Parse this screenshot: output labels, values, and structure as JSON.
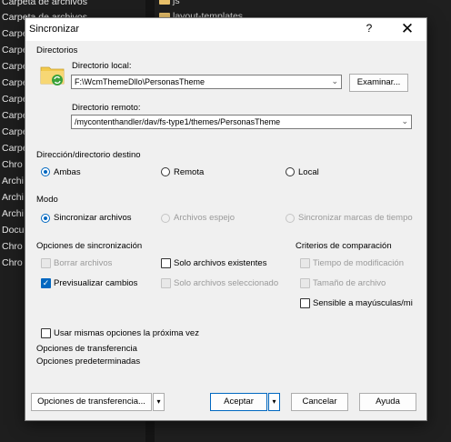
{
  "background": {
    "left_items": [
      "Carpeta de archivos",
      "Carpeta de archivos",
      "Carpe",
      "Carpe",
      "Carpe",
      "Carpe",
      "Carpe",
      "Carpe",
      "Carpe",
      "Carpe",
      "Chro",
      "Archi",
      "Archi",
      "Archi",
      "Docu",
      "Chro",
      "Chro"
    ],
    "right_items": [
      "js",
      "layout-templates"
    ]
  },
  "dialog": {
    "title": "Sincronizar",
    "help_label": "?",
    "close_label": "✕",
    "directories_heading": "Directorios",
    "local_dir_label": "Directorio local:",
    "local_dir_value": "F:\\WcmThemeDllo\\PersonasTheme",
    "browse_label": "Examinar...",
    "remote_dir_label": "Directorio remoto:",
    "remote_dir_value": "/mycontenthandler/dav/fs-type1/themes/PersonasTheme",
    "direction_heading": "Dirección/directorio destino",
    "direction_options": [
      "Ambas",
      "Remota",
      "Local"
    ],
    "direction_selected": "Ambas",
    "mode_heading": "Modo",
    "mode_options": [
      "Sincronizar archivos",
      "Archivos espejo",
      "Sincronizar marcas de tiempo"
    ],
    "mode_selected": "Sincronizar archivos",
    "sync_options_heading": "Opciones de sincronización",
    "opt_delete": "Borrar archivos",
    "opt_existing": "Solo archivos existentes",
    "opt_preview": "Previsualizar cambios",
    "opt_selected": "Solo archivos seleccionado",
    "compare_heading": "Criterios de comparación",
    "cmp_time": "Tiempo de modificación",
    "cmp_size": "Tamaño de archivo",
    "cmp_case": "Sensible a mayúsculas/mi",
    "same_options": "Usar mismas opciones la próxima vez",
    "transfer_options_heading": "Opciones de transferencia",
    "transfer_options_value": "Opciones predeterminadas",
    "transfer_button": "Opciones de transferencia...",
    "ok_button": "Aceptar",
    "cancel_button": "Cancelar",
    "help_button": "Ayuda",
    "checkmark": "✓",
    "chevron": "⌄",
    "dropdown_arrow": "▾",
    "colors": {
      "accent": "#0067c0",
      "folder": "#f2c94c",
      "sync_green": "#3aa13a"
    }
  }
}
